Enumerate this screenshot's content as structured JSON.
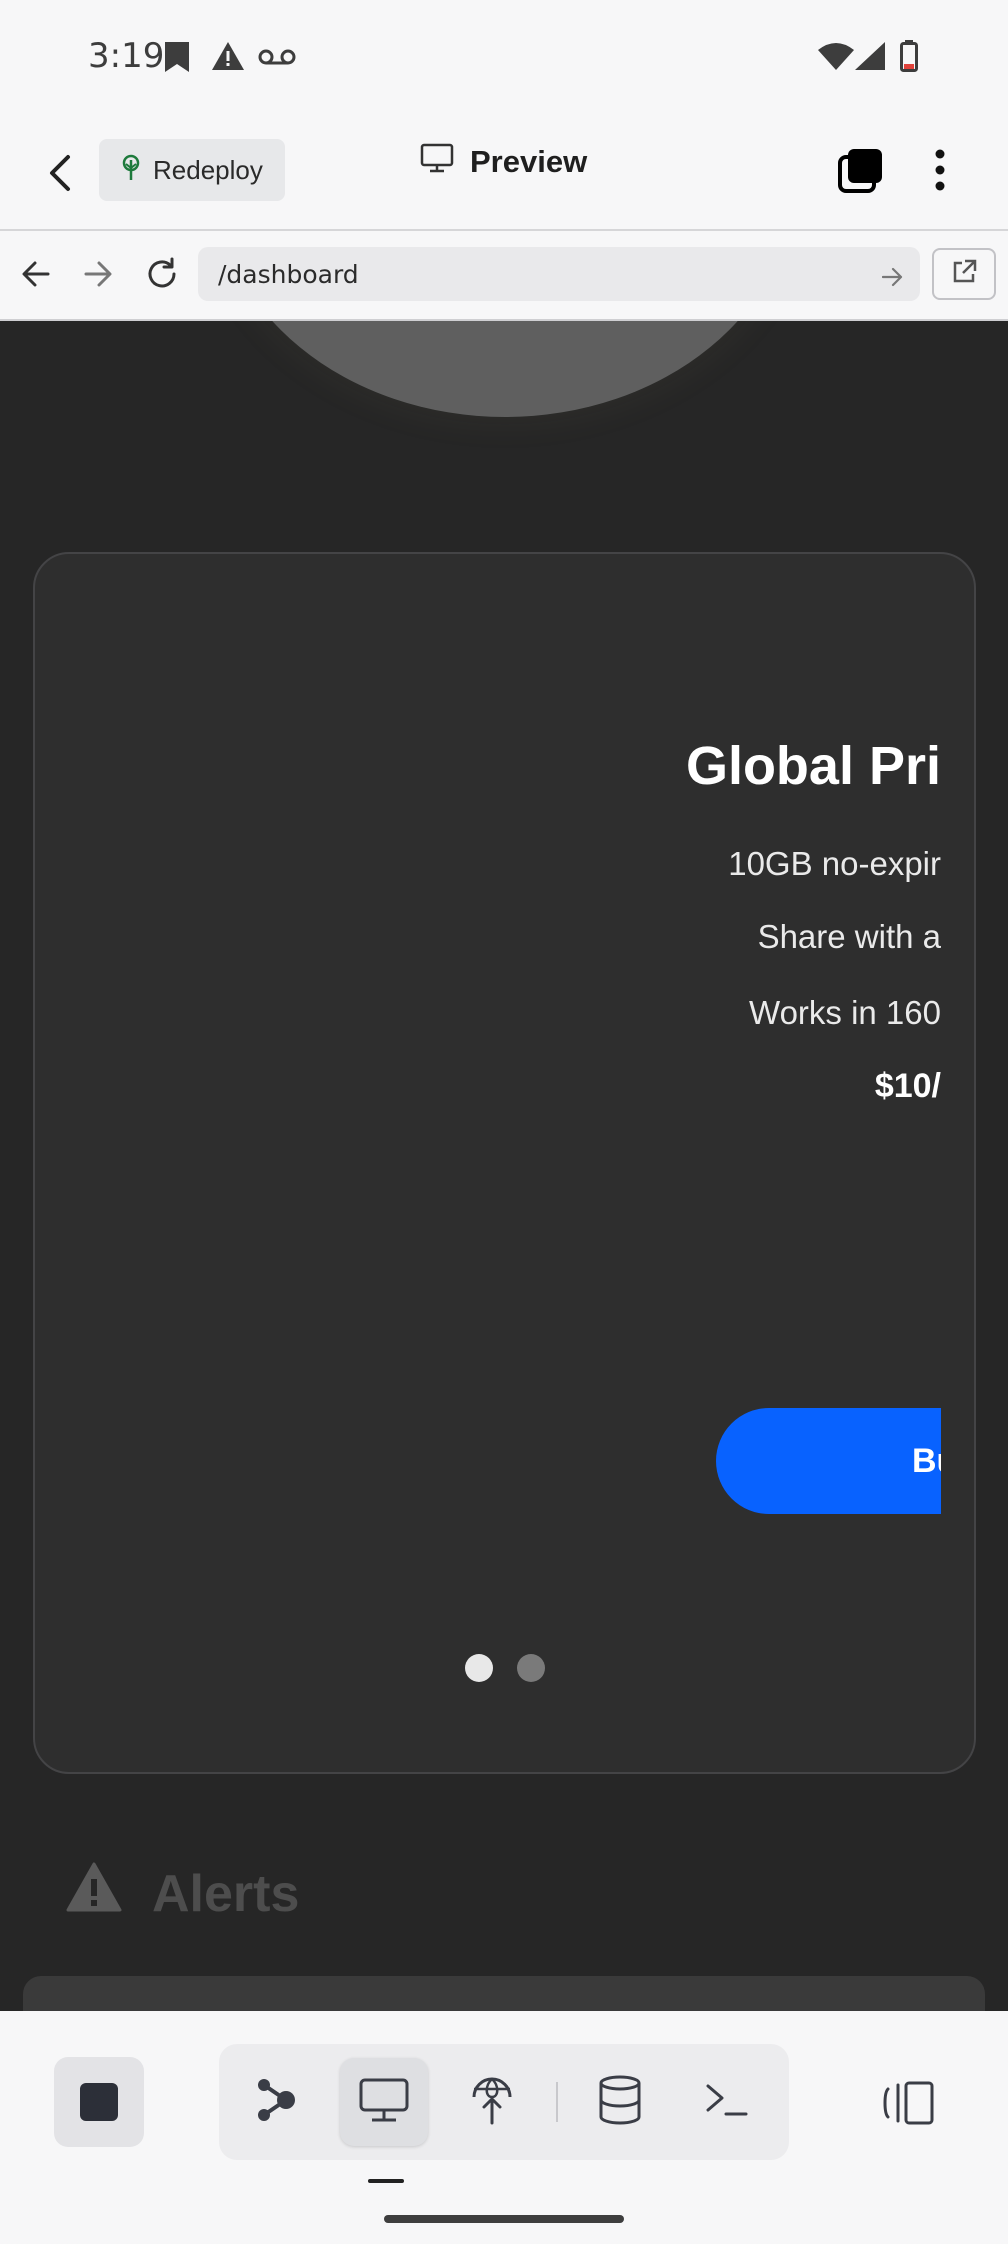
{
  "status_bar": {
    "time": "3:19"
  },
  "header": {
    "redeploy_label": "Redeploy",
    "title": "Preview"
  },
  "url_bar": {
    "path": "/dashboard"
  },
  "card": {
    "plan_title": "Global Pri",
    "features": [
      "10GB no-expir",
      "Share with a",
      "Works in 160"
    ],
    "price": "$10/",
    "buy_label": "Bu",
    "carousel": {
      "total": 2,
      "active": 1
    }
  },
  "alerts": {
    "label": "Alerts"
  },
  "colors": {
    "accent": "#0862ff",
    "card_bg": "#2e2e2e",
    "page_bg": "#262626"
  }
}
